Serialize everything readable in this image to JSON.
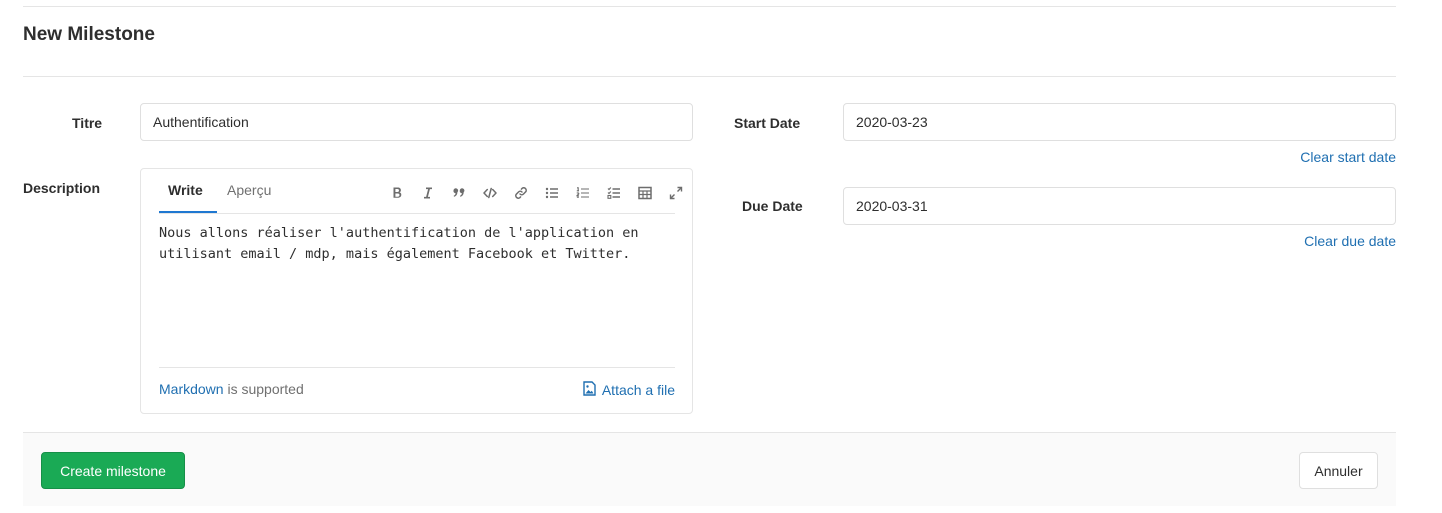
{
  "page": {
    "title": "New Milestone"
  },
  "form": {
    "title_label": "Titre",
    "title_value": "Authentification",
    "description_label": "Description",
    "start_date_label": "Start Date",
    "start_date_value": "2020-03-23",
    "clear_start_label": "Clear start date",
    "due_date_label": "Due Date",
    "due_date_value": "2020-03-31",
    "clear_due_label": "Clear due date"
  },
  "editor": {
    "tab_write": "Write",
    "tab_preview": "Aperçu",
    "toolbar": [
      "bold-icon",
      "italic-icon",
      "quote-icon",
      "code-icon",
      "link-icon",
      "bullet-list-icon",
      "numbered-list-icon",
      "task-list-icon",
      "table-icon",
      "fullscreen-icon"
    ],
    "content": "Nous allons réaliser l'authentification de l'application en utilisant email / mdp, mais également Facebook et Twitter.",
    "markdown_link": "Markdown",
    "markdown_suffix": " is supported",
    "attach_label": "Attach a file"
  },
  "actions": {
    "create_label": "Create milestone",
    "cancel_label": "Annuler"
  },
  "colors": {
    "primary_green": "#1aaa55",
    "link_blue": "#1f6fb1",
    "tab_active": "#1f78d1"
  }
}
